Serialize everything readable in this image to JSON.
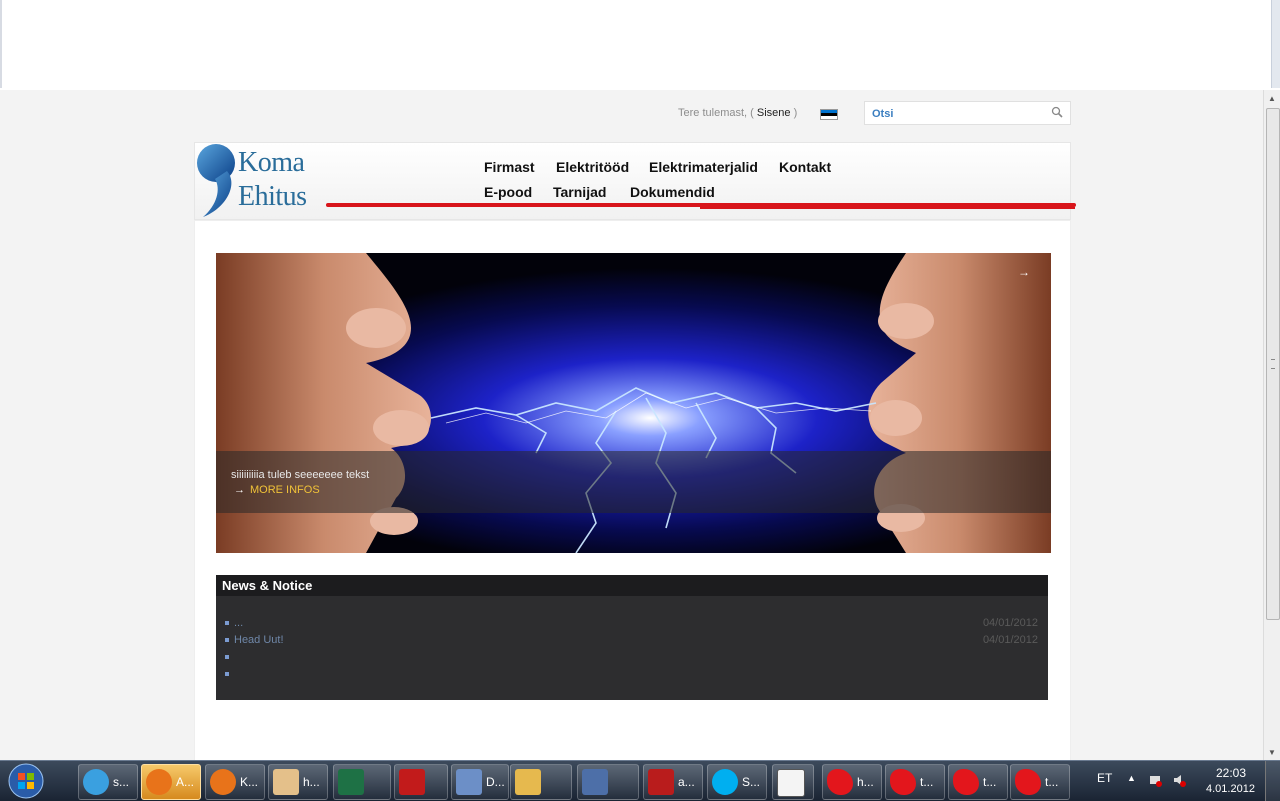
{
  "topbar": {
    "welcome_text": "Tere tulemast, (",
    "login_label": "Sisene",
    "welcome_close": " )",
    "search_placeholder": "Otsi",
    "flag_colors": [
      "#0072ce",
      "#000000",
      "#ffffff"
    ]
  },
  "logo": {
    "line1": "Koma",
    "line2": "Ehitus",
    "color": "#2a6d9a"
  },
  "nav": {
    "items": [
      "Firmast",
      "Elektritööd",
      "Elektrimaterjalid",
      "Kontakt",
      "E-pood",
      "Tarnijad",
      "Dokumendid"
    ]
  },
  "slider": {
    "caption": "siiiiiiiiia tuleb seeeeeee tekst",
    "more_label": "MORE INFOS",
    "next_glyph": "→"
  },
  "news": {
    "title": "News & Notice",
    "items": [
      {
        "text": "...",
        "date": "04/01/2012"
      },
      {
        "text": "Head Uut!",
        "date": "04/01/2012"
      },
      {
        "text": "",
        "date": ""
      },
      {
        "text": "",
        "date": ""
      }
    ]
  },
  "taskbar": {
    "tasks": [
      {
        "label": "s...",
        "icon": "messenger-icon"
      },
      {
        "label": "A...",
        "icon": "firefox-icon"
      },
      {
        "label": "K...",
        "icon": "firefox-icon"
      },
      {
        "label": "h...",
        "icon": "paint-icon"
      },
      {
        "label": "",
        "icon": "excel-icon"
      },
      {
        "label": "",
        "icon": "pdf-icon"
      },
      {
        "label": "D...",
        "icon": "document-icon"
      },
      {
        "label": "",
        "icon": "folder-icon"
      },
      {
        "label": "",
        "icon": "app-icon"
      },
      {
        "label": "a...",
        "icon": "filezilla-icon"
      },
      {
        "label": "S...",
        "icon": "skype-icon"
      },
      {
        "label": "",
        "icon": "notepad-icon"
      },
      {
        "label": "h...",
        "icon": "red-splat-icon"
      },
      {
        "label": "t...",
        "icon": "red-splat-icon"
      },
      {
        "label": "t...",
        "icon": "red-splat-icon"
      },
      {
        "label": "t...",
        "icon": "red-splat-icon"
      }
    ],
    "language": "ET",
    "time": "22:03",
    "date": "4.01.2012"
  },
  "colors": {
    "accent_red": "#d8151b",
    "news_link": "#6f87a8",
    "more_info": "#f0c238"
  }
}
